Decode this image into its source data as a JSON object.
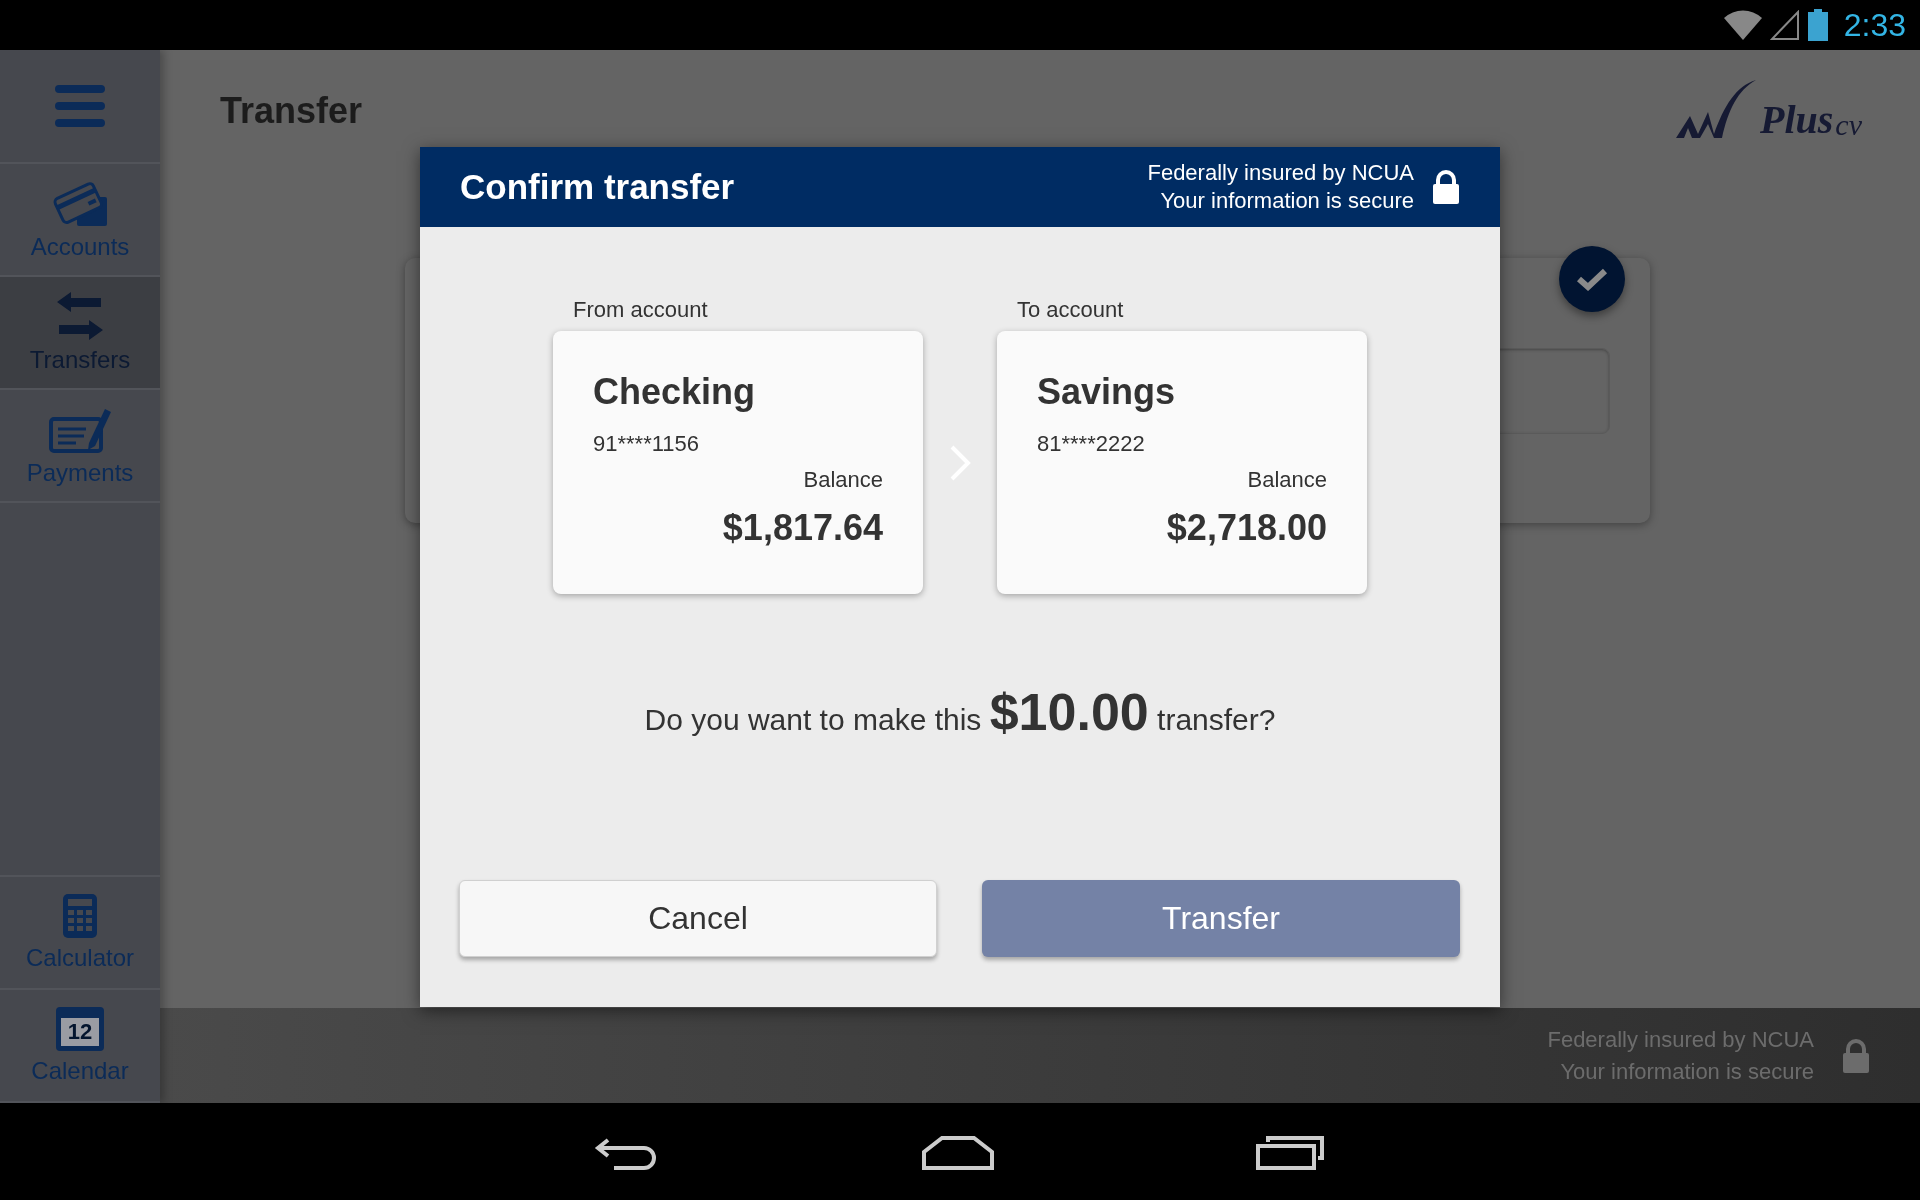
{
  "status_bar": {
    "time": "2:33"
  },
  "sidebar": {
    "items": [
      {
        "label": "Accounts",
        "selected": false
      },
      {
        "label": "Transfers",
        "selected": true
      },
      {
        "label": "Payments",
        "selected": false
      }
    ],
    "bottom_items": [
      {
        "label": "Calculator",
        "selected": false
      },
      {
        "label": "Calendar",
        "icon_text": "12",
        "selected": false
      }
    ]
  },
  "page": {
    "title": "Transfer"
  },
  "logo": {
    "text": "Plus",
    "suffix": "cv"
  },
  "footer": {
    "lines": [
      "Federally insured by NCUA",
      "Your information is secure"
    ]
  },
  "dialog": {
    "title": "Confirm transfer",
    "security_lines": [
      "Federally insured by NCUA",
      "Your information is secure"
    ],
    "from": {
      "label": "From account",
      "name": "Checking",
      "number": "91****1156",
      "balance_label": "Balance",
      "balance": "$1,817.64"
    },
    "to": {
      "label": "To account",
      "name": "Savings",
      "number": "81****2222",
      "balance_label": "Balance",
      "balance": "$2,718.00"
    },
    "question": {
      "before": "Do you want to make this",
      "amount": "$10.00",
      "after": "transfer?"
    },
    "buttons": [
      {
        "label": "Cancel",
        "kind": "secondary"
      },
      {
        "label": "Transfer",
        "kind": "primary"
      }
    ]
  }
}
